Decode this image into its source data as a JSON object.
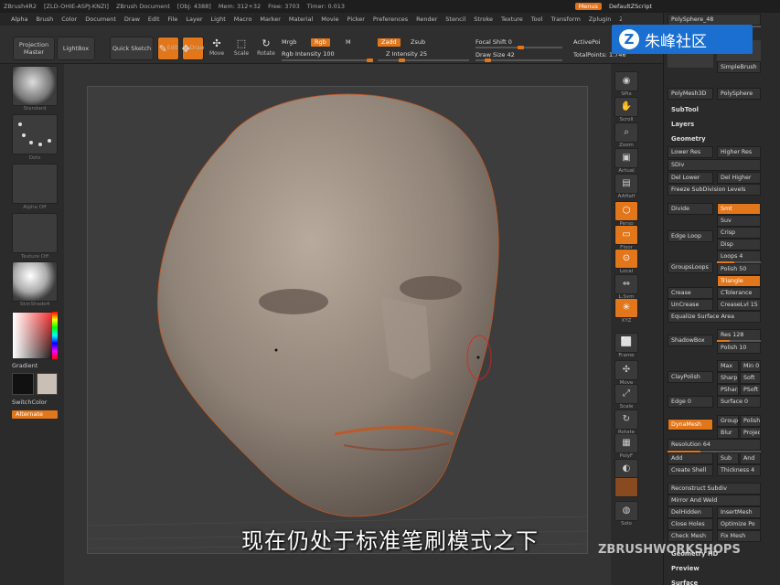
{
  "titlebar": {
    "app": "ZBrush4R2",
    "build": "[ZLD-OHIE-ASPJ-KNZI]",
    "document": "ZBrush Document",
    "mem": "[Obj: 4388]",
    "memstats": "Mem: 312+32",
    "free": "Free: 3703",
    "timer": "Timer: 0.013",
    "menus_label": "Menus",
    "script_label": "DefaultZScript"
  },
  "menubar": {
    "items": [
      "Alpha",
      "Brush",
      "Color",
      "Document",
      "Draw",
      "Edit",
      "File",
      "Layer",
      "Light",
      "Macro",
      "Marker",
      "Material",
      "Movie",
      "Picker",
      "Preferences",
      "Render",
      "Stencil",
      "Stroke",
      "Texture",
      "Tool",
      "Transform",
      "Zplugin",
      "Zscript"
    ]
  },
  "toolbar": {
    "projection_master": "Projection Master",
    "lightbox": "LightBox",
    "quick_sketch": "Quick Sketch",
    "edit": "Edit",
    "draw": "Draw",
    "move": "Move",
    "scale": "Scale",
    "rotate": "Rotate",
    "mrgb": "Mrgb",
    "rgb": "Rgb",
    "m": "M",
    "rgb_intensity": "Rgb Intensity 100",
    "zadd": "Zadd",
    "zsub": "Zsub",
    "z_intensity": "Z Intensity 25",
    "focal_shift": "Focal Shift 0",
    "draw_size": "Draw Size 42",
    "active_points": "ActivePoi",
    "total_points": "TotalPoints: 1.746"
  },
  "leftshelf": {
    "brush_label": "Standard",
    "stroke_label": "Dots",
    "alpha_label": "Alpha Off",
    "texture_label": "Texture Off",
    "material_label": "SkinShade4",
    "gradient": "Gradient",
    "switch_color": "SwitchColor",
    "alternate": "Alternate"
  },
  "righticons": {
    "spix": "SPix",
    "scroll": "Scroll",
    "zoom": "Zoom",
    "actual": "Actual",
    "aahalf": "AAHalf",
    "persp": "Persp",
    "floor": "Floor",
    "local": "Local",
    "lsym": "L.Sym",
    "xyz": "XYZ",
    "frame": "Frame",
    "move": "Move",
    "scale": "Scale",
    "rotate": "Rotate",
    "polyf": "PolyF",
    "transp": "Transp",
    "solo": "Solo"
  },
  "rightpanel": {
    "polysphere": "PolySphere_48",
    "simplebrush": "SimpleBrush",
    "polymesh3d": "PolyMesh3D",
    "polysphere2": "PolySphere",
    "subtool": "SubTool",
    "layers": "Layers",
    "geometry": "Geometry",
    "lower_res": "Lower Res",
    "higher_res": "Higher Res",
    "sdiv": "SDiv",
    "del_lower": "Del Lower",
    "del_higher": "Del Higher",
    "freeze": "Freeze SubDivision Levels",
    "reconstruct": "Reconstruct Subdiv",
    "divide": "Divide",
    "smt": "Smt",
    "suv": "Suv",
    "edge_loop": "Edge Loop",
    "crisp": "Crisp",
    "disp": "Disp",
    "group_loops": "GroupsLoops",
    "loops": "Loops 4",
    "polish": "Polish 50",
    "triangle": "Triangle",
    "crease": "Crease",
    "ctolerance": "CTolerance",
    "uncrease": "UnCrease",
    "creaselvl": "CreaseLvl 15",
    "equalize": "Equalize Surface Area",
    "shadowbox": "ShadowBox",
    "res": "Res 128",
    "polish2": "Polish 10",
    "claypolish": "ClayPolish",
    "max": "Max",
    "min": "Min 0",
    "sharp": "Sharp",
    "soft": "Soft",
    "psharp": "PSharp",
    "psoft": "PSoft",
    "edge": "Edge 0",
    "surface": "Surface 0",
    "dynamesh": "DynaMesh",
    "group": "Group",
    "polish3": "Polish",
    "blur": "Blur",
    "project": "Project",
    "resolution": "Resolution 64",
    "add": "Add",
    "sub": "Sub",
    "and": "And",
    "create_shell": "Create Shell",
    "thickness": "Thickness 4",
    "reconstruct2": "Reconstruct Subdiv",
    "mirror_weld": "Mirror And Weld",
    "delhidden": "DelHidden",
    "insertmesh": "InsertMesh",
    "close_holes": "Close Holes",
    "optimize": "Optimize Po",
    "check_mesh": "Check Mesh",
    "fix_mesh": "Fix Mesh",
    "geometry_hd": "Geometry HD",
    "preview": "Preview",
    "surface2": "Surface"
  },
  "watermark": {
    "logo_glyph": "Z",
    "logo_text": "朱峰社区",
    "subtitle": "现在仍处于标准笔刷模式之下",
    "zbw": "ZBRUSHWORKSHOPS"
  }
}
